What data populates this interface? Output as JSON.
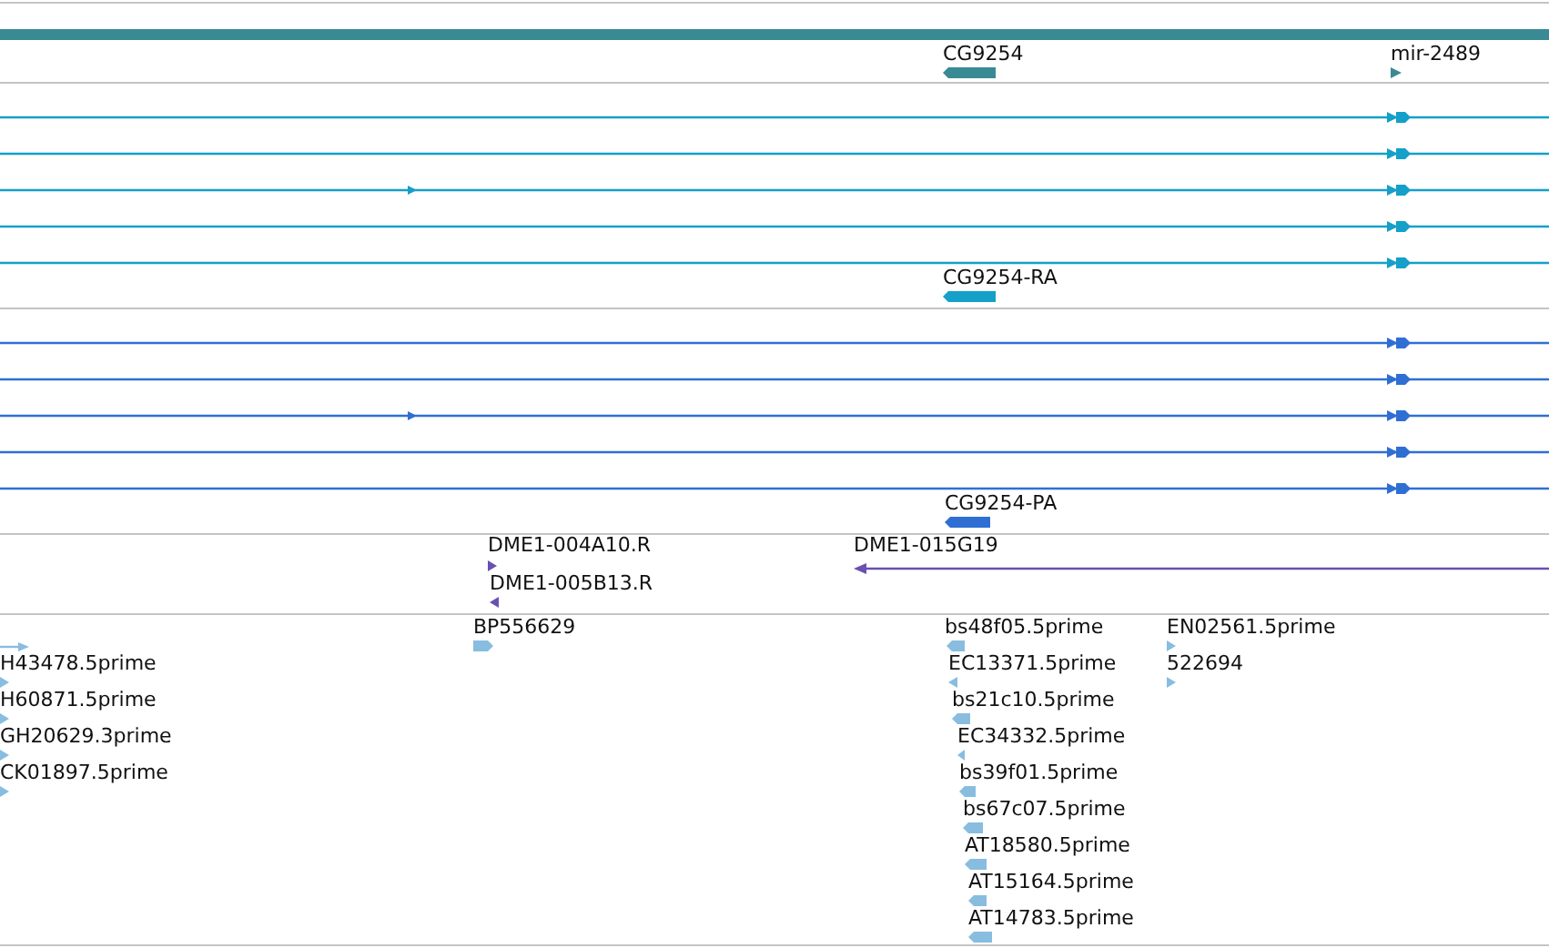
{
  "tracks": [
    {
      "kind": "genes",
      "color": "#3a8a94",
      "features": [
        {
          "label": "CG9254",
          "reverse": true
        },
        {
          "label": "mir-2489",
          "reverse": false
        }
      ]
    },
    {
      "kind": "transcripts",
      "color": "#14a0c8",
      "features": [
        {
          "label": "CG9254-RA",
          "reverse": true
        }
      ]
    },
    {
      "kind": "transcripts",
      "color": "#2f6fd4",
      "features": [
        {
          "label": "CG9254-PA",
          "reverse": true
        }
      ]
    },
    {
      "kind": "clones",
      "color": "#6a50b0",
      "features": [
        {
          "label": "DME1-004A10.R",
          "reverse": false
        },
        {
          "label": "DME1-015G19",
          "reverse": true
        },
        {
          "label": "DME1-005B13.R",
          "reverse": true
        }
      ]
    },
    {
      "kind": "ests",
      "color": "#88bde0",
      "features": [
        {
          "label": "BP556629",
          "reverse": false
        },
        {
          "label": "bs48f05.5prime",
          "reverse": true
        },
        {
          "label": "EN02561.5prime",
          "reverse": false
        },
        {
          "label": "H43478.5prime",
          "reverse": false
        },
        {
          "label": "EC13371.5prime",
          "reverse": true
        },
        {
          "label": "522694",
          "reverse": false
        },
        {
          "label": "H60871.5prime",
          "reverse": false
        },
        {
          "label": "bs21c10.5prime",
          "reverse": true
        },
        {
          "label": "GH20629.3prime",
          "reverse": false
        },
        {
          "label": "EC34332.5prime",
          "reverse": true
        },
        {
          "label": "CK01897.5prime",
          "reverse": false
        },
        {
          "label": "bs39f01.5prime",
          "reverse": true
        },
        {
          "label": "bs67c07.5prime",
          "reverse": true
        },
        {
          "label": "AT18580.5prime",
          "reverse": true
        },
        {
          "label": "AT15164.5prime",
          "reverse": true
        },
        {
          "label": "AT14783.5prime",
          "reverse": true
        }
      ]
    }
  ]
}
